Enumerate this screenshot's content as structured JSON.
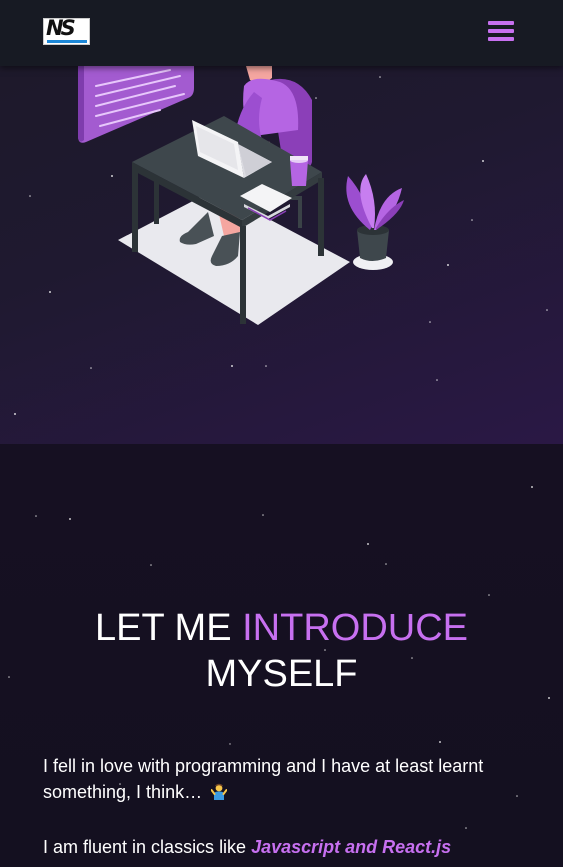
{
  "navbar": {
    "logo": {
      "text": "NS",
      "icon": "logo-icon"
    },
    "menu_icon": "hamburger-menu-icon"
  },
  "about": {
    "heading_part1": "LET ME ",
    "heading_highlight": "INTRODUCE",
    "heading_part2": "MYSELF",
    "paragraph1_text": "I fell in love with programming and I have at least learnt something, I think…",
    "paragraph1_emoji": "person-shrugging-icon",
    "paragraph2_text": "I am fluent in classics like ",
    "paragraph2_highlight": "Javascript and React.js"
  },
  "colors": {
    "accent": "#c770f0",
    "navbar_bg": "#171a23",
    "page_bg": "#140f22"
  }
}
